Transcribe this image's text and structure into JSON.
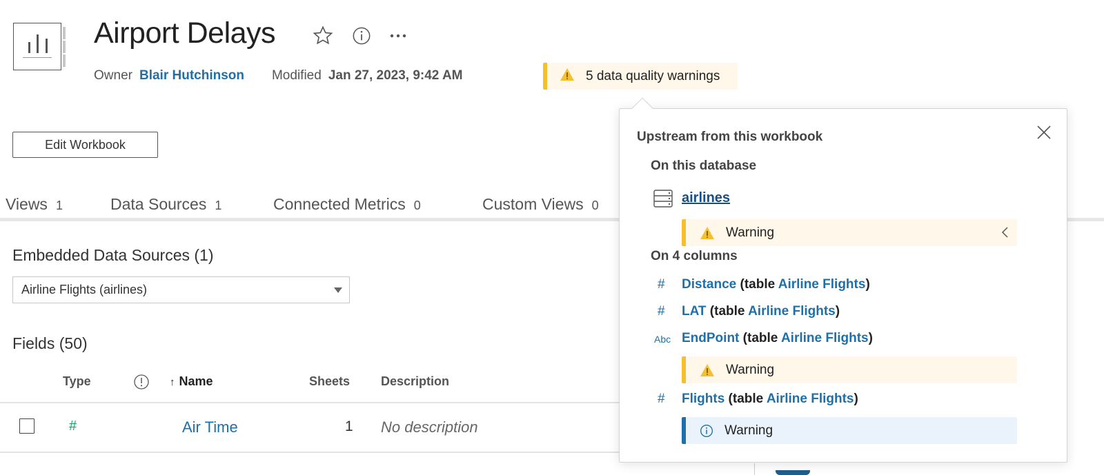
{
  "header": {
    "title": "Airport Delays",
    "owner_label": "Owner",
    "owner_name": "Blair Hutchinson",
    "modified_label": "Modified",
    "modified_value": "Jan 27, 2023, 9:42 AM",
    "icons": [
      "star-icon",
      "info-icon",
      "more-icon"
    ]
  },
  "data_quality": {
    "badge_text": "5 data quality warnings",
    "colors": {
      "warning": "#f5c02f",
      "info": "#1f6fa8"
    }
  },
  "toolbar": {
    "edit_label": "Edit Workbook"
  },
  "tabs": [
    {
      "label": "Views",
      "count": "1"
    },
    {
      "label": "Data Sources",
      "count": "1"
    },
    {
      "label": "Connected Metrics",
      "count": "0"
    },
    {
      "label": "Custom Views",
      "count": "0"
    }
  ],
  "embedded": {
    "title": "Embedded Data Sources (1)",
    "selected": "Airline Flights (airlines)"
  },
  "fields": {
    "title": "Fields (50)",
    "columns": {
      "type": "Type",
      "name": "Name",
      "sheets": "Sheets",
      "description": "Description"
    },
    "rows": [
      {
        "type_icon": "#",
        "name": "Air Time",
        "sheets": "1",
        "description": "No description"
      }
    ]
  },
  "popover": {
    "title": "Upstream from this workbook",
    "database_heading": "On this database",
    "database_name": "airlines",
    "database_warning": "Warning",
    "columns_heading": "On 4 columns",
    "table_word": "table",
    "columns": [
      {
        "type_icon": "#",
        "name": "Distance",
        "table": "Airline Flights",
        "warning": null
      },
      {
        "type_icon": "#",
        "name": "LAT",
        "table": "Airline Flights",
        "warning": null
      },
      {
        "type_icon": "Abc",
        "name": "EndPoint",
        "table": "Airline Flights",
        "warning": "Warning",
        "warning_level": "warning"
      },
      {
        "type_icon": "#",
        "name": "Flights",
        "table": "Airline Flights",
        "warning": "Warning",
        "warning_level": "info"
      }
    ]
  }
}
